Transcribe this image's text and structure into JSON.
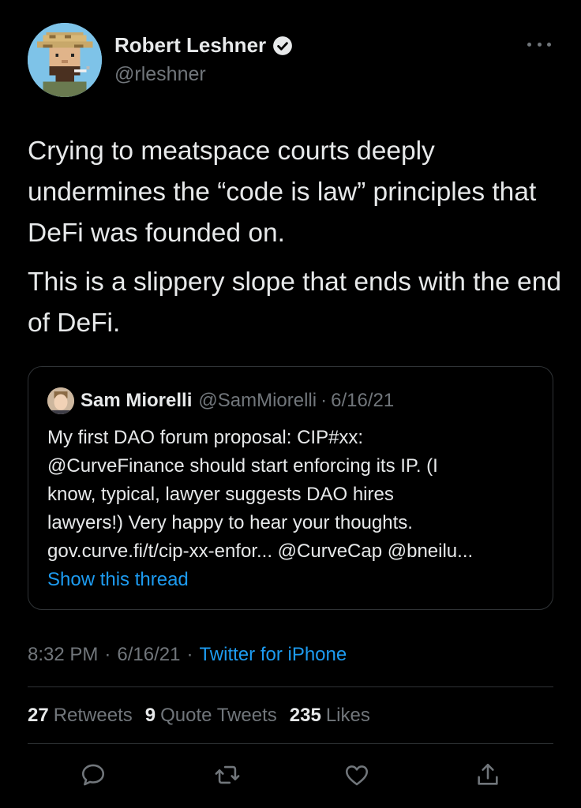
{
  "author": {
    "name": "Robert Leshner",
    "handle": "@rleshner",
    "verified": true
  },
  "tweet": {
    "paragraphs": [
      "Crying to meatspace courts deeply undermines the “code is law” principles that DeFi was founded on.",
      "This is a slippery slope that ends with the end of DeFi."
    ]
  },
  "quote": {
    "name": "Sam Miorelli",
    "handle": "@SamMiorelli",
    "separator": "·",
    "date": "6/16/21",
    "text_lines": [
      "My first DAO forum proposal: CIP#xx:",
      "@CurveFinance should start enforcing its IP. (I",
      "know, typical, lawyer suggests DAO hires",
      "lawyers!) Very happy to hear your thoughts.",
      "gov.curve.fi/t/cip-xx-enfor... @CurveCap @bneilu..."
    ],
    "show_thread": "Show this thread"
  },
  "meta": {
    "time": "8:32 PM",
    "separator": "·",
    "date": "6/16/21",
    "source": "Twitter for iPhone"
  },
  "stats": {
    "retweets_count": "27",
    "retweets_label": "Retweets",
    "quotes_count": "9",
    "quotes_label": "Quote Tweets",
    "likes_count": "235",
    "likes_label": "Likes"
  },
  "actions": {
    "icons": [
      "reply-icon",
      "retweet-icon",
      "like-icon",
      "share-icon"
    ]
  },
  "colors": {
    "background": "#000000",
    "text": "#e7e9ea",
    "muted": "#71767b",
    "link": "#1d9bf0",
    "border": "#2f3336"
  }
}
